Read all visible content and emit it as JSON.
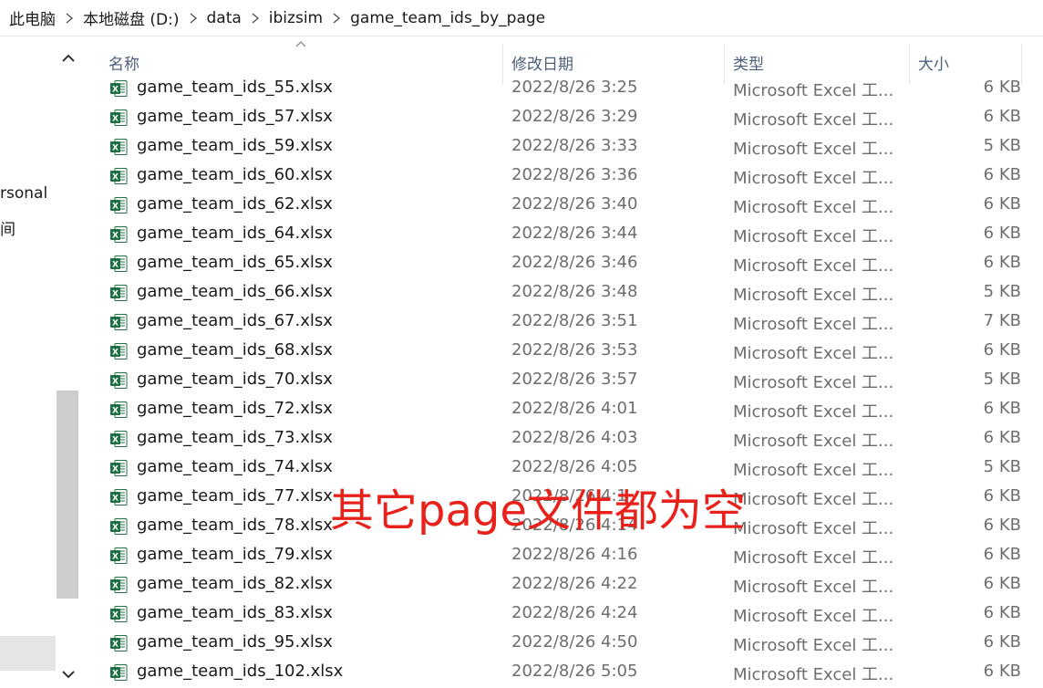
{
  "breadcrumb": [
    "此电脑",
    "本地磁盘 (D:)",
    "data",
    "ibizsim",
    "game_team_ids_by_page"
  ],
  "nav": {
    "partial_item_1": "rsonal",
    "partial_item_2": "间"
  },
  "columns": {
    "name": "名称",
    "date": "修改日期",
    "type": "类型",
    "size": "大小"
  },
  "files": [
    {
      "name": "game_team_ids_55.xlsx",
      "date": "2022/8/26 3:25",
      "type": "Microsoft Excel 工...",
      "size": "6 KB"
    },
    {
      "name": "game_team_ids_57.xlsx",
      "date": "2022/8/26 3:29",
      "type": "Microsoft Excel 工...",
      "size": "6 KB"
    },
    {
      "name": "game_team_ids_59.xlsx",
      "date": "2022/8/26 3:33",
      "type": "Microsoft Excel 工...",
      "size": "5 KB"
    },
    {
      "name": "game_team_ids_60.xlsx",
      "date": "2022/8/26 3:36",
      "type": "Microsoft Excel 工...",
      "size": "6 KB"
    },
    {
      "name": "game_team_ids_62.xlsx",
      "date": "2022/8/26 3:40",
      "type": "Microsoft Excel 工...",
      "size": "6 KB"
    },
    {
      "name": "game_team_ids_64.xlsx",
      "date": "2022/8/26 3:44",
      "type": "Microsoft Excel 工...",
      "size": "6 KB"
    },
    {
      "name": "game_team_ids_65.xlsx",
      "date": "2022/8/26 3:46",
      "type": "Microsoft Excel 工...",
      "size": "6 KB"
    },
    {
      "name": "game_team_ids_66.xlsx",
      "date": "2022/8/26 3:48",
      "type": "Microsoft Excel 工...",
      "size": "5 KB"
    },
    {
      "name": "game_team_ids_67.xlsx",
      "date": "2022/8/26 3:51",
      "type": "Microsoft Excel 工...",
      "size": "7 KB"
    },
    {
      "name": "game_team_ids_68.xlsx",
      "date": "2022/8/26 3:53",
      "type": "Microsoft Excel 工...",
      "size": "6 KB"
    },
    {
      "name": "game_team_ids_70.xlsx",
      "date": "2022/8/26 3:57",
      "type": "Microsoft Excel 工...",
      "size": "5 KB"
    },
    {
      "name": "game_team_ids_72.xlsx",
      "date": "2022/8/26 4:01",
      "type": "Microsoft Excel 工...",
      "size": "6 KB"
    },
    {
      "name": "game_team_ids_73.xlsx",
      "date": "2022/8/26 4:03",
      "type": "Microsoft Excel 工...",
      "size": "6 KB"
    },
    {
      "name": "game_team_ids_74.xlsx",
      "date": "2022/8/26 4:05",
      "type": "Microsoft Excel 工...",
      "size": "5 KB"
    },
    {
      "name": "game_team_ids_77.xlsx",
      "date": "2022/8/26 4:1",
      "type": "Microsoft Excel 工...",
      "size": "6 KB"
    },
    {
      "name": "game_team_ids_78.xlsx",
      "date": "2022/8/26 4:14",
      "type": "Microsoft Excel 工...",
      "size": "6 KB"
    },
    {
      "name": "game_team_ids_79.xlsx",
      "date": "2022/8/26 4:16",
      "type": "Microsoft Excel 工...",
      "size": "6 KB"
    },
    {
      "name": "game_team_ids_82.xlsx",
      "date": "2022/8/26 4:22",
      "type": "Microsoft Excel 工...",
      "size": "6 KB"
    },
    {
      "name": "game_team_ids_83.xlsx",
      "date": "2022/8/26 4:24",
      "type": "Microsoft Excel 工...",
      "size": "6 KB"
    },
    {
      "name": "game_team_ids_95.xlsx",
      "date": "2022/8/26 4:50",
      "type": "Microsoft Excel 工...",
      "size": "6 KB"
    },
    {
      "name": "game_team_ids_102.xlsx",
      "date": "2022/8/26 5:05",
      "type": "Microsoft Excel 工...",
      "size": "6 KB"
    }
  ],
  "annotation": "其它page文件都为空",
  "colors": {
    "excel_green": "#1e7145",
    "annotation_red": "#e8211b",
    "header_text": "#4c607a",
    "detail_text": "#6d6d6d"
  },
  "icons": {
    "breadcrumb_separator": "chevron-right-icon",
    "file": "excel-file-icon",
    "scroll_up": "chevron-up-icon",
    "scroll_down": "chevron-down-icon",
    "sort": "sort-ascending-icon"
  }
}
